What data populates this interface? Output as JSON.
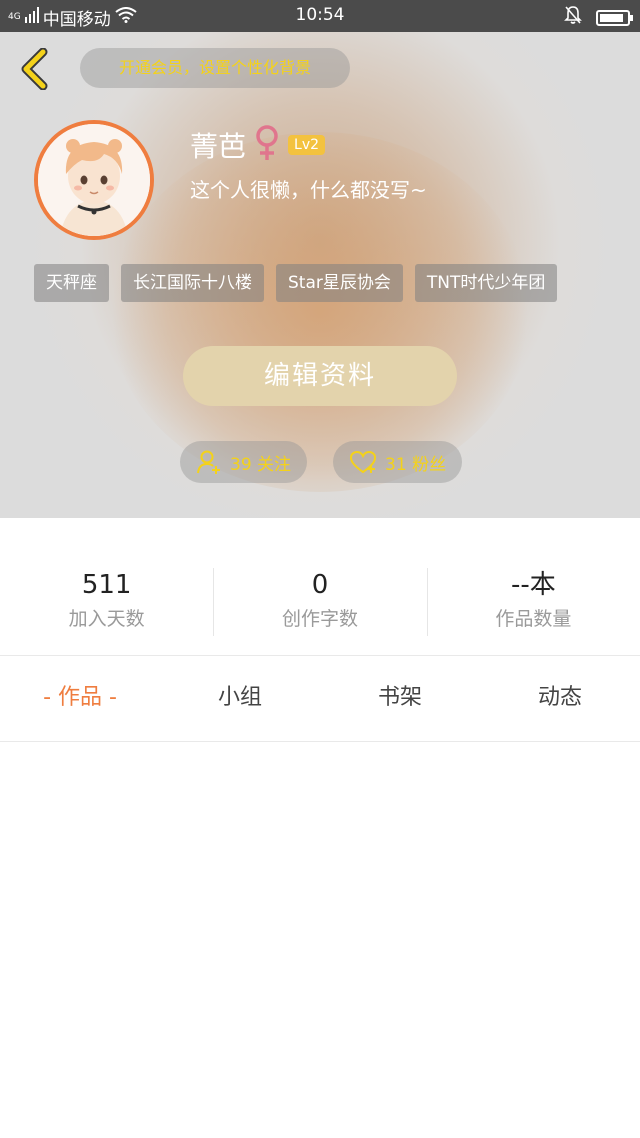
{
  "status_bar": {
    "network": "4G",
    "carrier": "中国移动",
    "time": "10:54",
    "battery_level": 0.9
  },
  "header": {
    "vip_banner": "开通会员，设置个性化背景",
    "nickname": "菁芭",
    "level": "Lv2",
    "bio": "这个人很懒，什么都没写~",
    "tags": [
      "天秤座",
      "长江国际十八楼",
      "Star星辰协会",
      "TNT时代少年团"
    ],
    "edit_button": "编辑资料",
    "following": "39 关注",
    "followers": "31 粉丝"
  },
  "stats": [
    {
      "value": "511",
      "label": "加入天数"
    },
    {
      "value": "0",
      "label": "创作字数"
    },
    {
      "value": "--本",
      "label": "作品数量"
    }
  ],
  "tabs": [
    {
      "label": "- 作品 -",
      "active": true
    },
    {
      "label": "小组",
      "active": false
    },
    {
      "label": "书架",
      "active": false
    },
    {
      "label": "动态",
      "active": false
    }
  ],
  "colors": {
    "accent": "#ef7d3f",
    "vip_text": "#f4d21a",
    "edit_button": "#e3d3ac",
    "level_badge": "#f3c23f",
    "female_icon": "#e0758d"
  }
}
